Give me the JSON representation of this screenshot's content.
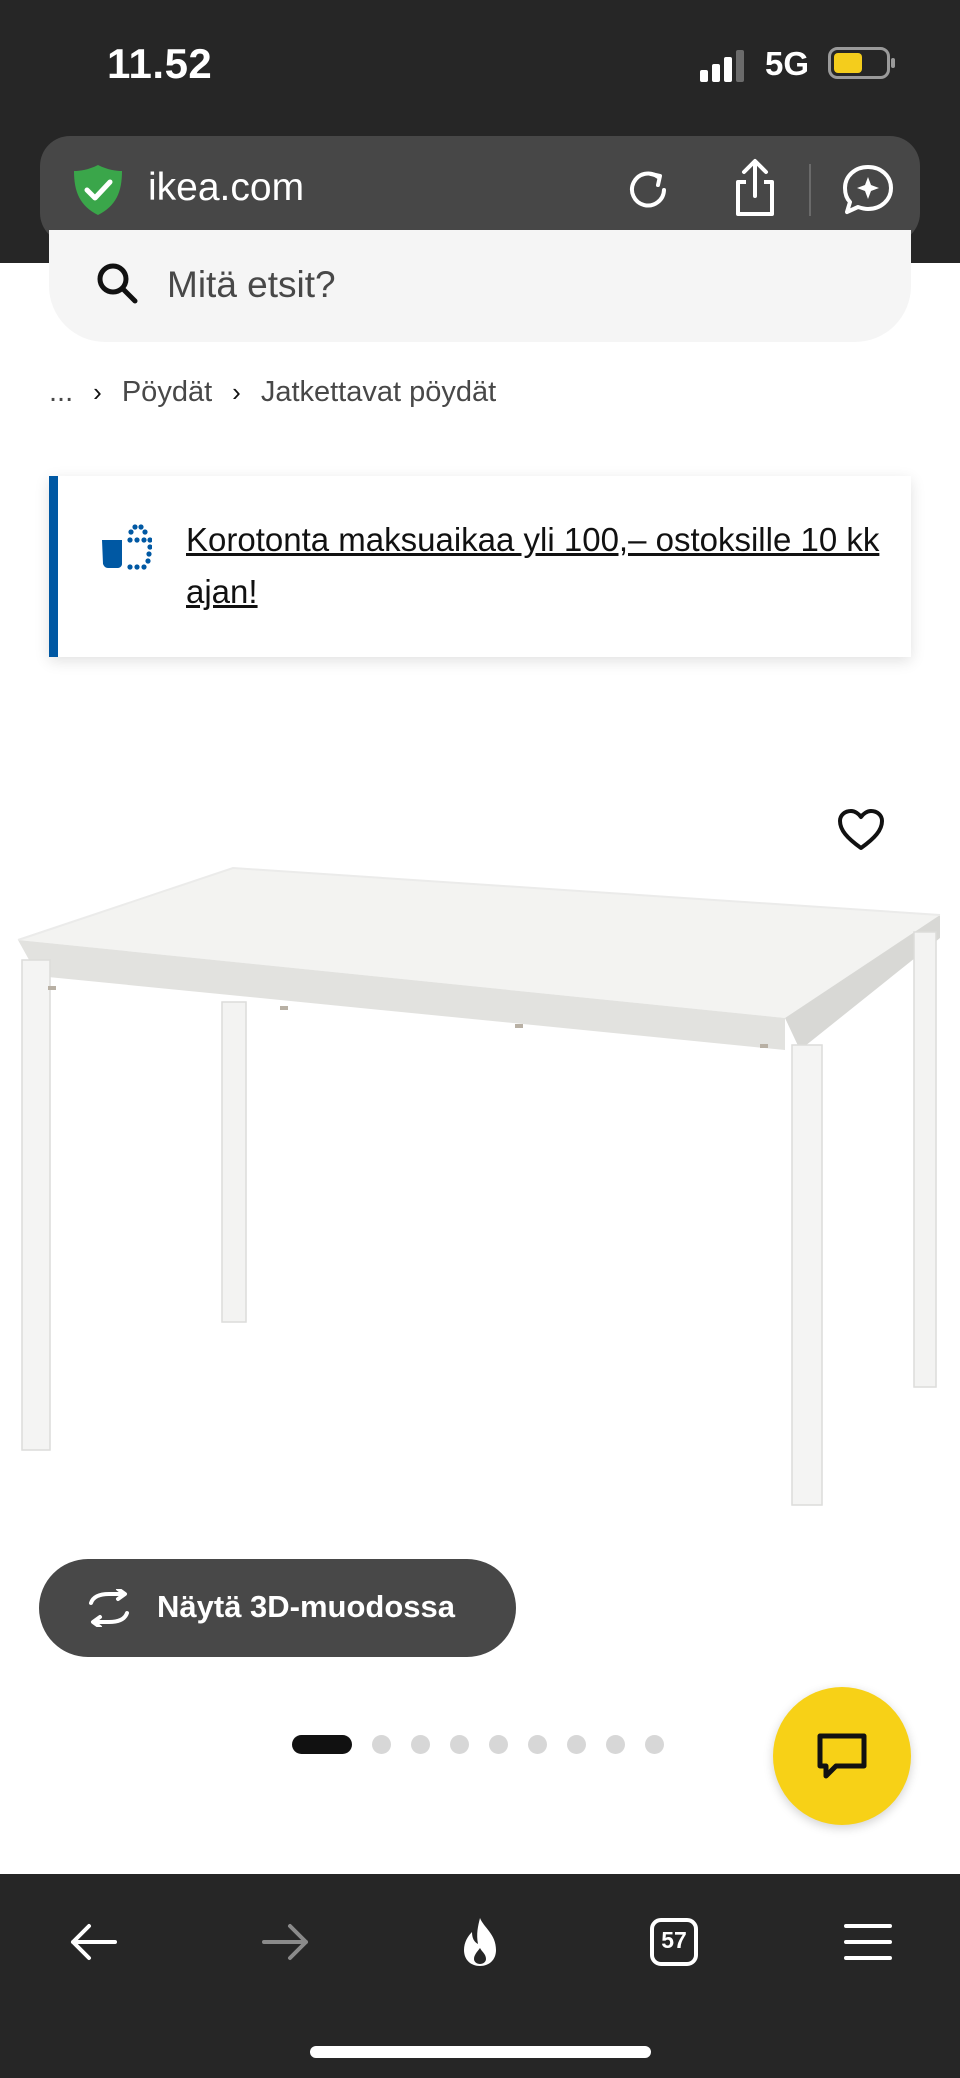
{
  "status_bar": {
    "time": "11.52",
    "network": "5G"
  },
  "browser": {
    "url": "ikea.com",
    "tab_count": "57"
  },
  "search": {
    "placeholder": "Mitä etsit?"
  },
  "breadcrumb": {
    "ellipsis": "...",
    "items": [
      "Pöydät",
      "Jatkettavat pöydät"
    ]
  },
  "promo": {
    "text": "Korotonta maksuaikaa yli 100,– ostoksille 10 kk ajan!"
  },
  "product": {
    "view_3d_label": "Näytä 3D-muodossa",
    "image_count": 9,
    "active_image_index": 0
  },
  "colors": {
    "chrome": "#262626",
    "url_bar": "#474747",
    "ikea_blue": "#0058a3",
    "ikea_yellow": "#f7d117",
    "button_dark": "#484848"
  }
}
